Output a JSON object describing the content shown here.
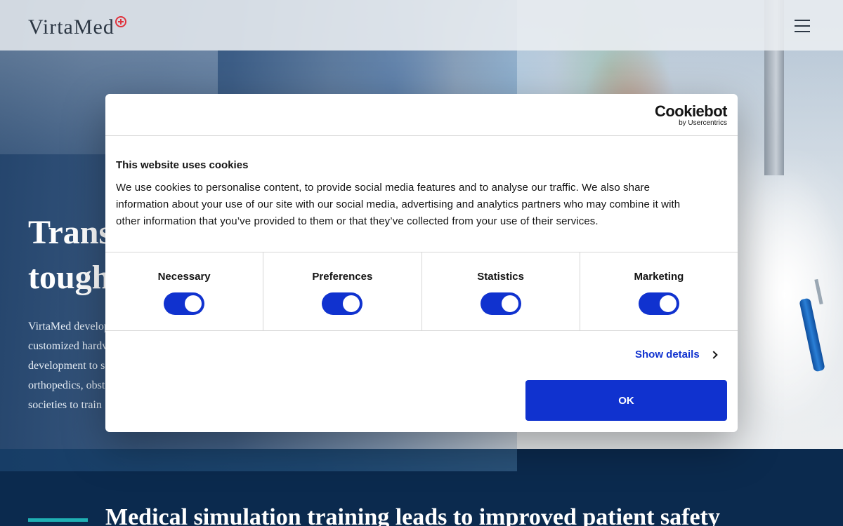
{
  "header": {
    "logo_text_main": "Virta",
    "logo_text_second": "Med",
    "menu_icon": "hamburger-menu-icon"
  },
  "hero": {
    "title_line1": "Trans",
    "title_line2": "tough",
    "text_lines": [
      "VirtaMed develop",
      "customized hardv",
      "development to s",
      "orthopedics, obst",
      "societies to train"
    ]
  },
  "section": {
    "title": "Medical simulation training leads to improved patient safety"
  },
  "cookie_dialog": {
    "brand_name": "Cookiebot",
    "brand_sub": "by Usercentrics",
    "title": "This website uses cookies",
    "body_lines": [
      "We use cookies to personalise content, to provide social media features and to analyse our traffic. We also share",
      "information about your use of our site with our social media, advertising and analytics partners who may combine it with",
      "other information that you’ve provided to them or that they’ve collected from your use of their services."
    ],
    "categories": [
      {
        "label": "Necessary",
        "enabled": true
      },
      {
        "label": "Preferences",
        "enabled": true
      },
      {
        "label": "Statistics",
        "enabled": true
      },
      {
        "label": "Marketing",
        "enabled": true
      }
    ],
    "show_details_label": "Show details",
    "ok_label": "OK"
  },
  "colors": {
    "accent_blue": "#1032cf",
    "logo_red": "#e0323c",
    "teal_accent": "#1fb0b4",
    "navy": "#0b2a4e"
  }
}
